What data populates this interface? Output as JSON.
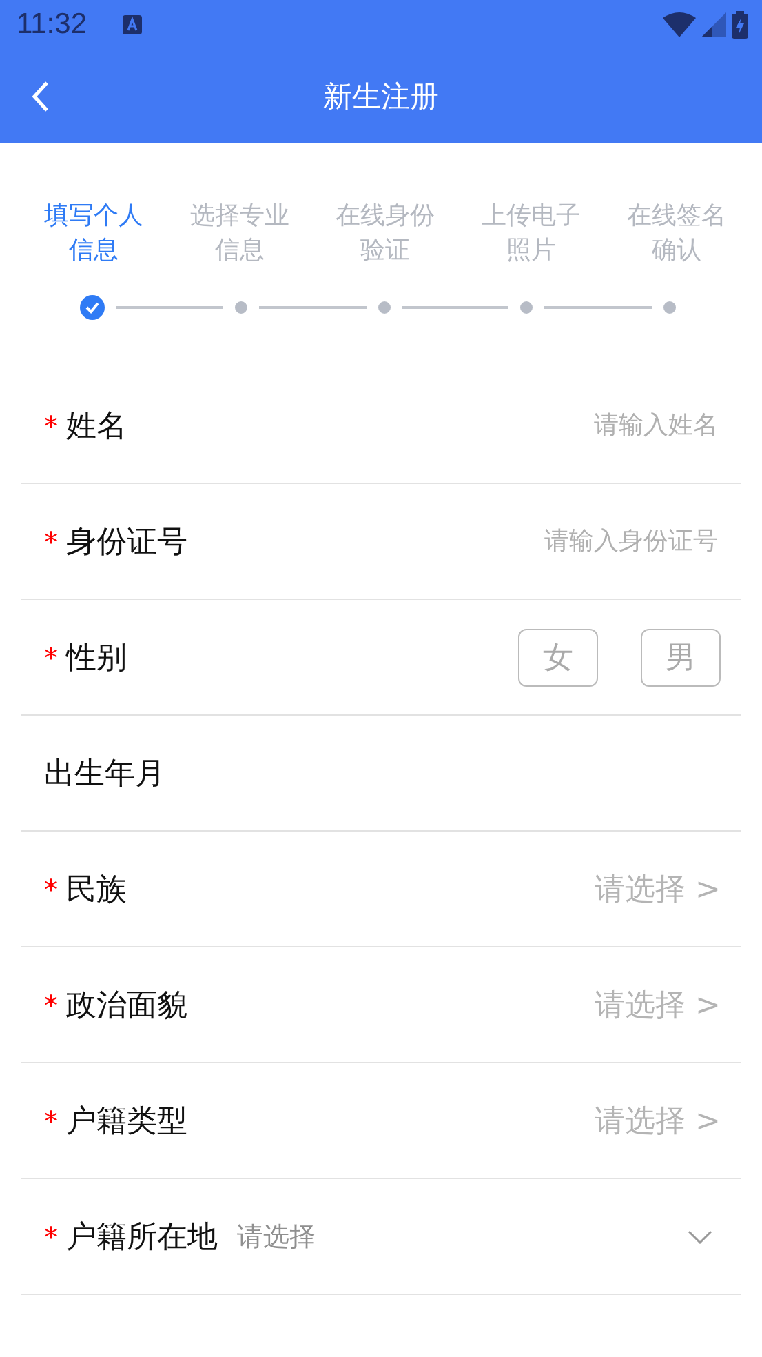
{
  "status_bar": {
    "time": "11:32"
  },
  "header": {
    "title": "新生注册"
  },
  "steps": [
    {
      "label": "填写个人信息",
      "selected": true,
      "done": true
    },
    {
      "label": "选择专业信息",
      "selected": false,
      "done": false
    },
    {
      "label": "在线身份验证",
      "selected": false,
      "done": false
    },
    {
      "label": "上传电子照片",
      "selected": false,
      "done": false
    },
    {
      "label": "在线签名确认",
      "selected": false,
      "done": false
    }
  ],
  "fields": [
    {
      "kind": "input",
      "required_mark": "*",
      "label": "姓名",
      "placeholder": "请输入姓名"
    },
    {
      "kind": "input",
      "required_mark": "*",
      "label": "身份证号",
      "placeholder": "请输入身份证号"
    },
    {
      "kind": "gender",
      "required_mark": "*",
      "label": "性别",
      "options": [
        {
          "label": "女",
          "selected": false
        },
        {
          "label": "男",
          "selected": false
        }
      ]
    },
    {
      "kind": "plain",
      "label": "出生年月"
    },
    {
      "kind": "select",
      "required_mark": "*",
      "label": "民族",
      "value": "请选择 >"
    },
    {
      "kind": "select",
      "required_mark": "*",
      "label": "政治面貌",
      "value": "请选择 >"
    },
    {
      "kind": "select",
      "required_mark": "*",
      "label": "户籍类型",
      "value": "请选择 >"
    },
    {
      "kind": "dropdown",
      "required_mark": "*",
      "label": "户籍所在地",
      "placeholder": "请选择"
    }
  ]
}
